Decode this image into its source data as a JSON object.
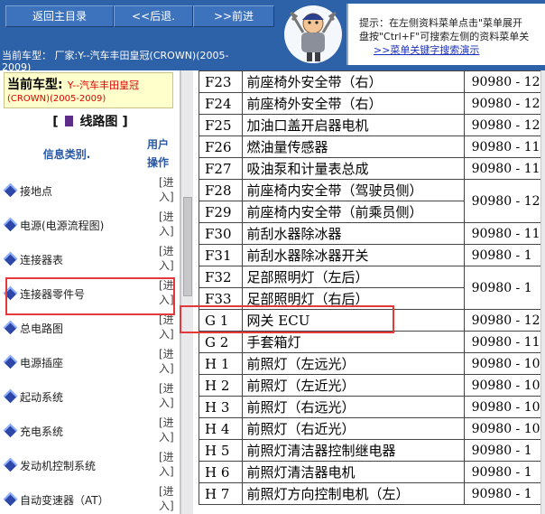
{
  "nav": {
    "home_label": "返回主目录",
    "back_label": "<<后退.",
    "forward_label": ">>前进"
  },
  "header": {
    "car_line_1": "当前车型：  厂家:Y--汽车丰田皇冠(CROWN)(2005-",
    "car_line_2": "2009)"
  },
  "tip": {
    "line1": "提示：在左侧资料菜单点击\"菜单展开",
    "line2": "盘按\"Ctrl+F\"可搜索左侧的资料菜单关",
    "link": ">>菜单关键字搜索演示"
  },
  "sidebar": {
    "vehicle_label": "当前车型:",
    "vehicle_value": "Y--汽车丰田皇冠",
    "vehicle_value2": "(CROWN)(2005-2009)",
    "section_open": "[",
    "section_title": "线路图",
    "section_close": "]",
    "col_info": "信息类别.",
    "col_op_1": "用户",
    "col_op_2": "操作",
    "enter_label": "[进入]",
    "items": [
      {
        "label": "接地点"
      },
      {
        "label": "电源(电源流程图)"
      },
      {
        "label": "连接器表"
      },
      {
        "label": "连接器零件号"
      },
      {
        "label": "总电路图"
      },
      {
        "label": "电源插座"
      },
      {
        "label": "起动系统"
      },
      {
        "label": "充电系统"
      },
      {
        "label": "发动机控制系统"
      },
      {
        "label": "自动变速器（AT）"
      }
    ]
  },
  "table": {
    "rows": [
      {
        "code": "F23",
        "name": "前座椅外安全带（右）",
        "part": "90980 - 12"
      },
      {
        "code": "F24",
        "name": "前座椅外安全带（右）",
        "part": "90980 - 12"
      },
      {
        "code": "F25",
        "name": "加油口盖开启器电机",
        "part": "90980 - 12"
      },
      {
        "code": "F26",
        "name": "燃油量传感器",
        "part": "90980 - 11"
      },
      {
        "code": "F27",
        "name": "吸油泵和计量表总成",
        "part": "90980 - 11"
      },
      {
        "code": "F28",
        "name": "前座椅内安全带（驾驶员侧）",
        "part": "90980 - 12"
      },
      {
        "code": "F29",
        "name": "前座椅内安全带（前乘员侧）",
        "part": ""
      },
      {
        "code": "F30",
        "name": "前刮水器除冰器",
        "part": "90980 - 11"
      },
      {
        "code": "F31",
        "name": "前刮水器除冰器开关",
        "part": "90980 - 1"
      },
      {
        "code": "F32",
        "name": "足部照明灯（左后）",
        "part": "90980 - 1"
      },
      {
        "code": "F33",
        "name": "足部照明灯（右后）",
        "part": ""
      },
      {
        "code": "G 1",
        "name": "网关 ECU",
        "part": "90980 - 12"
      },
      {
        "code": "G 2",
        "name": "手套箱灯",
        "part": "90980 - 11"
      },
      {
        "code": "H 1",
        "name": "前照灯（左远光）",
        "part": "90980 - 10"
      },
      {
        "code": "H 2",
        "name": "前照灯（左近光）",
        "part": "90980 - 10"
      },
      {
        "code": "H 3",
        "name": "前照灯（右远光）",
        "part": "90980 - 10"
      },
      {
        "code": "H 4",
        "name": "前照灯（右近光）",
        "part": "90980 - 10"
      },
      {
        "code": "H 5",
        "name": "前照灯清洁器控制继电器",
        "part": "90980 - 1"
      },
      {
        "code": "H 6",
        "name": "前照灯清洁器电机",
        "part": "90980 - 1"
      },
      {
        "code": "H 7",
        "name": "前照灯方向控制电机（左）",
        "part": "90980 - 1"
      }
    ]
  },
  "colors": {
    "header_bg": "#2d61a8",
    "highlight": "#e5383b",
    "vehicle_value": "#dd0000",
    "link": "#1a2fbf"
  }
}
